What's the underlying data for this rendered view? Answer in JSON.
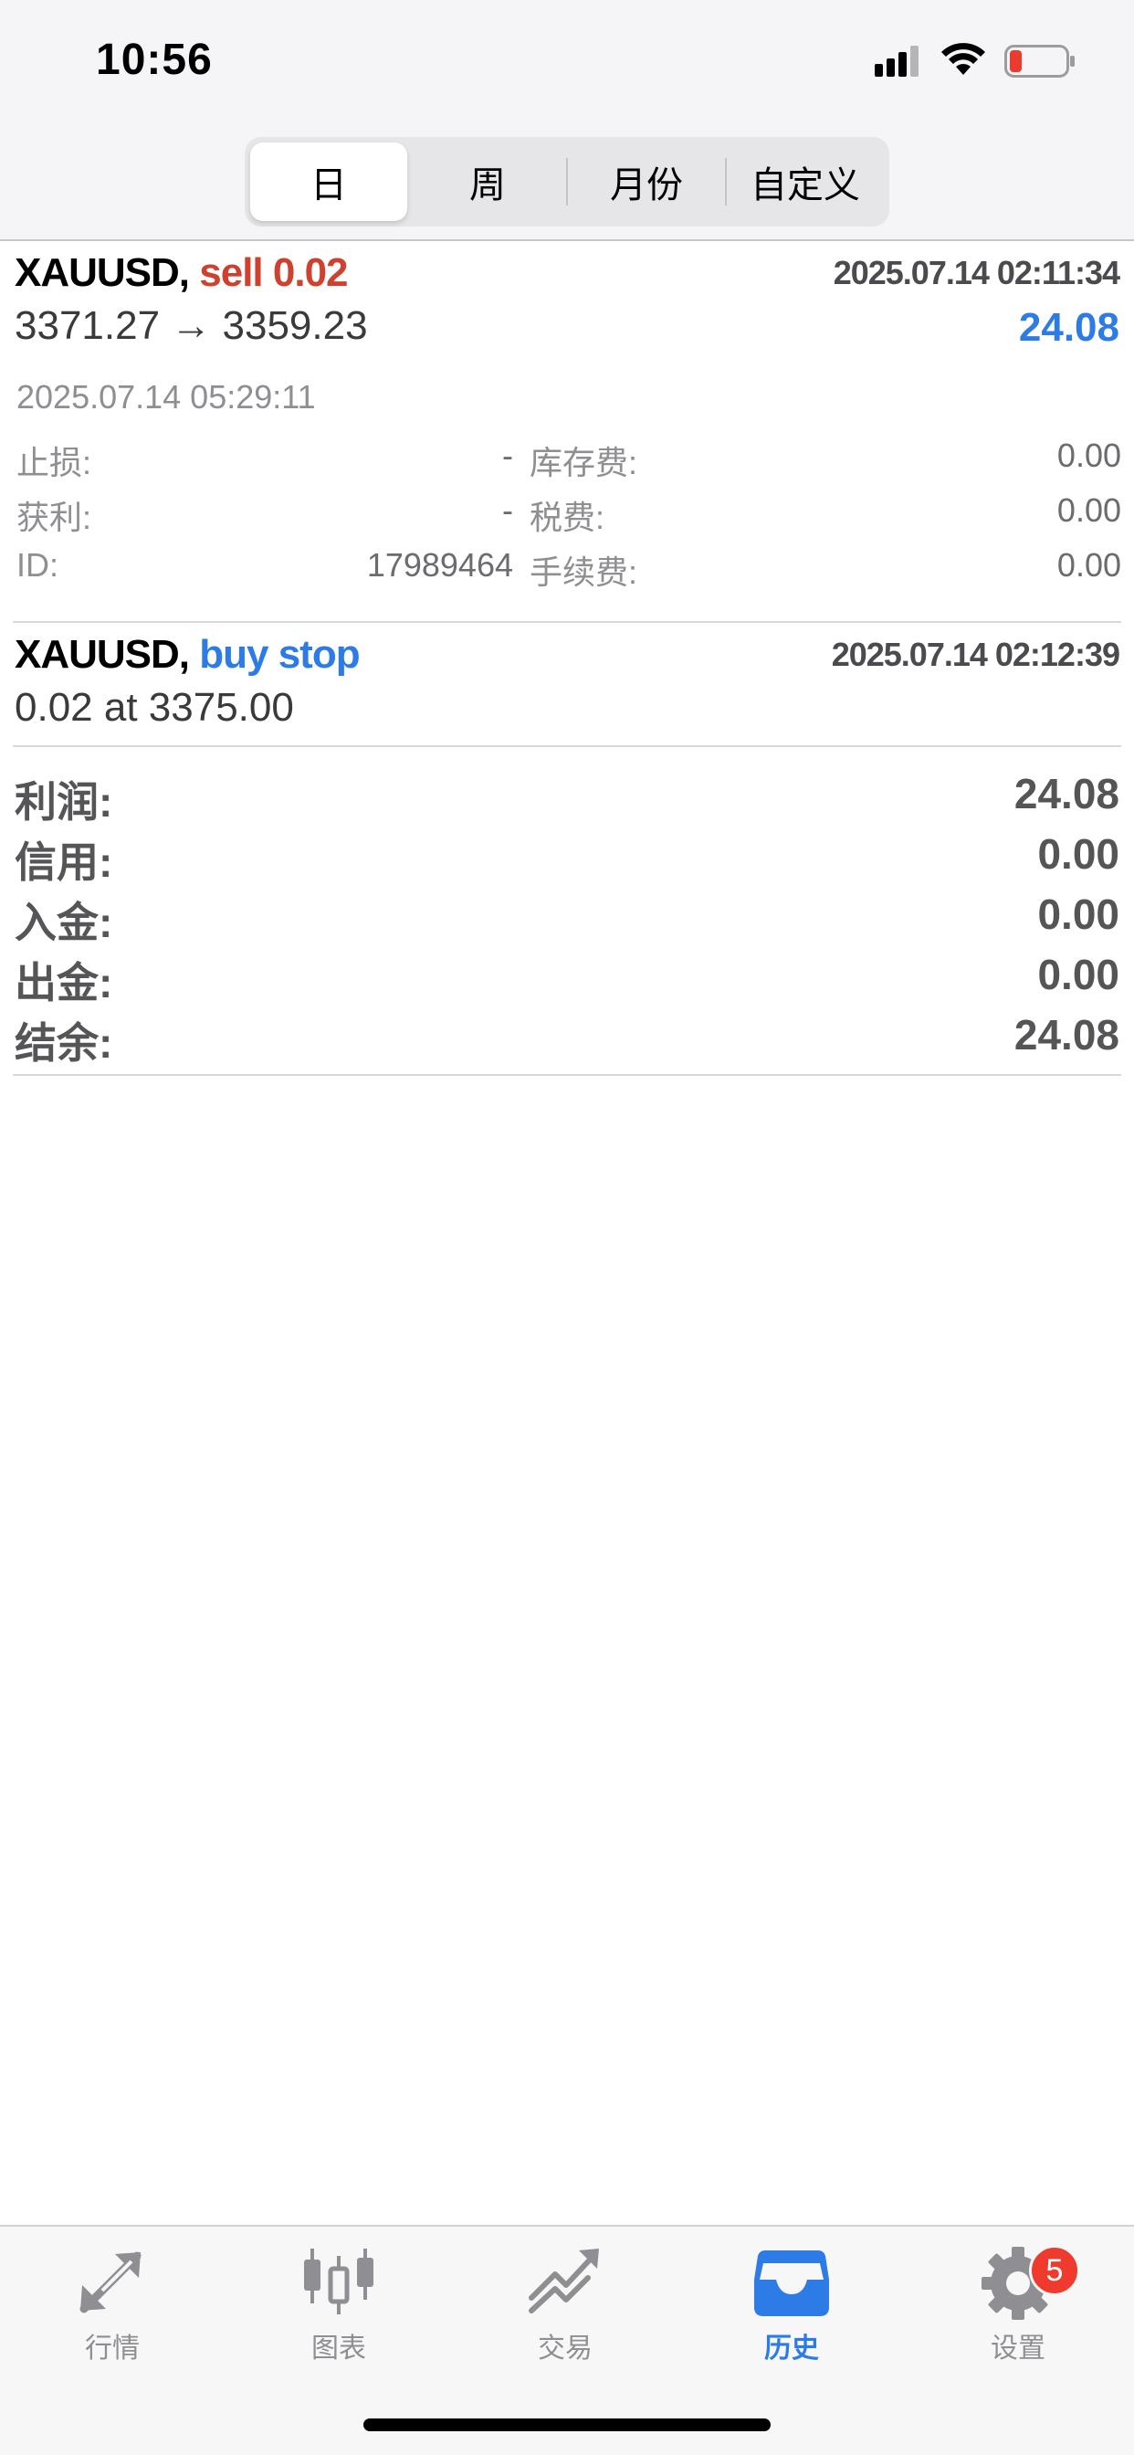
{
  "status_bar": {
    "time": "10:56"
  },
  "segments": [
    {
      "label": "日",
      "active": true
    },
    {
      "label": "周",
      "active": false
    },
    {
      "label": "月份",
      "active": false
    },
    {
      "label": "自定义",
      "active": false
    }
  ],
  "deals": [
    {
      "symbol": "XAUUSD,",
      "action": "sell 0.02",
      "open_time": "2025.07.14 02:11:34",
      "price_line": "3371.27 → 3359.23",
      "profit": "24.08",
      "close_time": "2025.07.14 05:29:11",
      "details": {
        "sl_label": "止损:",
        "sl_value": "-",
        "swap_label": "库存费:",
        "swap_value": "0.00",
        "tp_label": "获利:",
        "tp_value": "-",
        "tax_label": "税费:",
        "tax_value": "0.00",
        "id_label": "ID:",
        "id_value": "17989464",
        "commission_label": "手续费:",
        "commission_value": "0.00"
      }
    }
  ],
  "orders": [
    {
      "symbol": "XAUUSD,",
      "action": "buy stop",
      "time": "2025.07.14 02:12:39",
      "order_line": "0.02 at 3375.00"
    }
  ],
  "summary": [
    {
      "label": "利润:",
      "value": "24.08"
    },
    {
      "label": "信用:",
      "value": "0.00"
    },
    {
      "label": "入金:",
      "value": "0.00"
    },
    {
      "label": "出金:",
      "value": "0.00"
    },
    {
      "label": "结余:",
      "value": "24.08"
    }
  ],
  "tab_bar": {
    "tabs": [
      {
        "label": "行情",
        "icon": "quotes-arrows-icon"
      },
      {
        "label": "图表",
        "icon": "candlestick-chart-icon"
      },
      {
        "label": "交易",
        "icon": "trade-chart-icon"
      },
      {
        "label": "历史",
        "icon": "history-inbox-icon",
        "active": true
      },
      {
        "label": "设置",
        "icon": "gear-icon",
        "badge": "5"
      }
    ]
  },
  "colors": {
    "accent": "#2d7be6",
    "sell": "#d0402f",
    "badge": "#ef3b2d"
  }
}
